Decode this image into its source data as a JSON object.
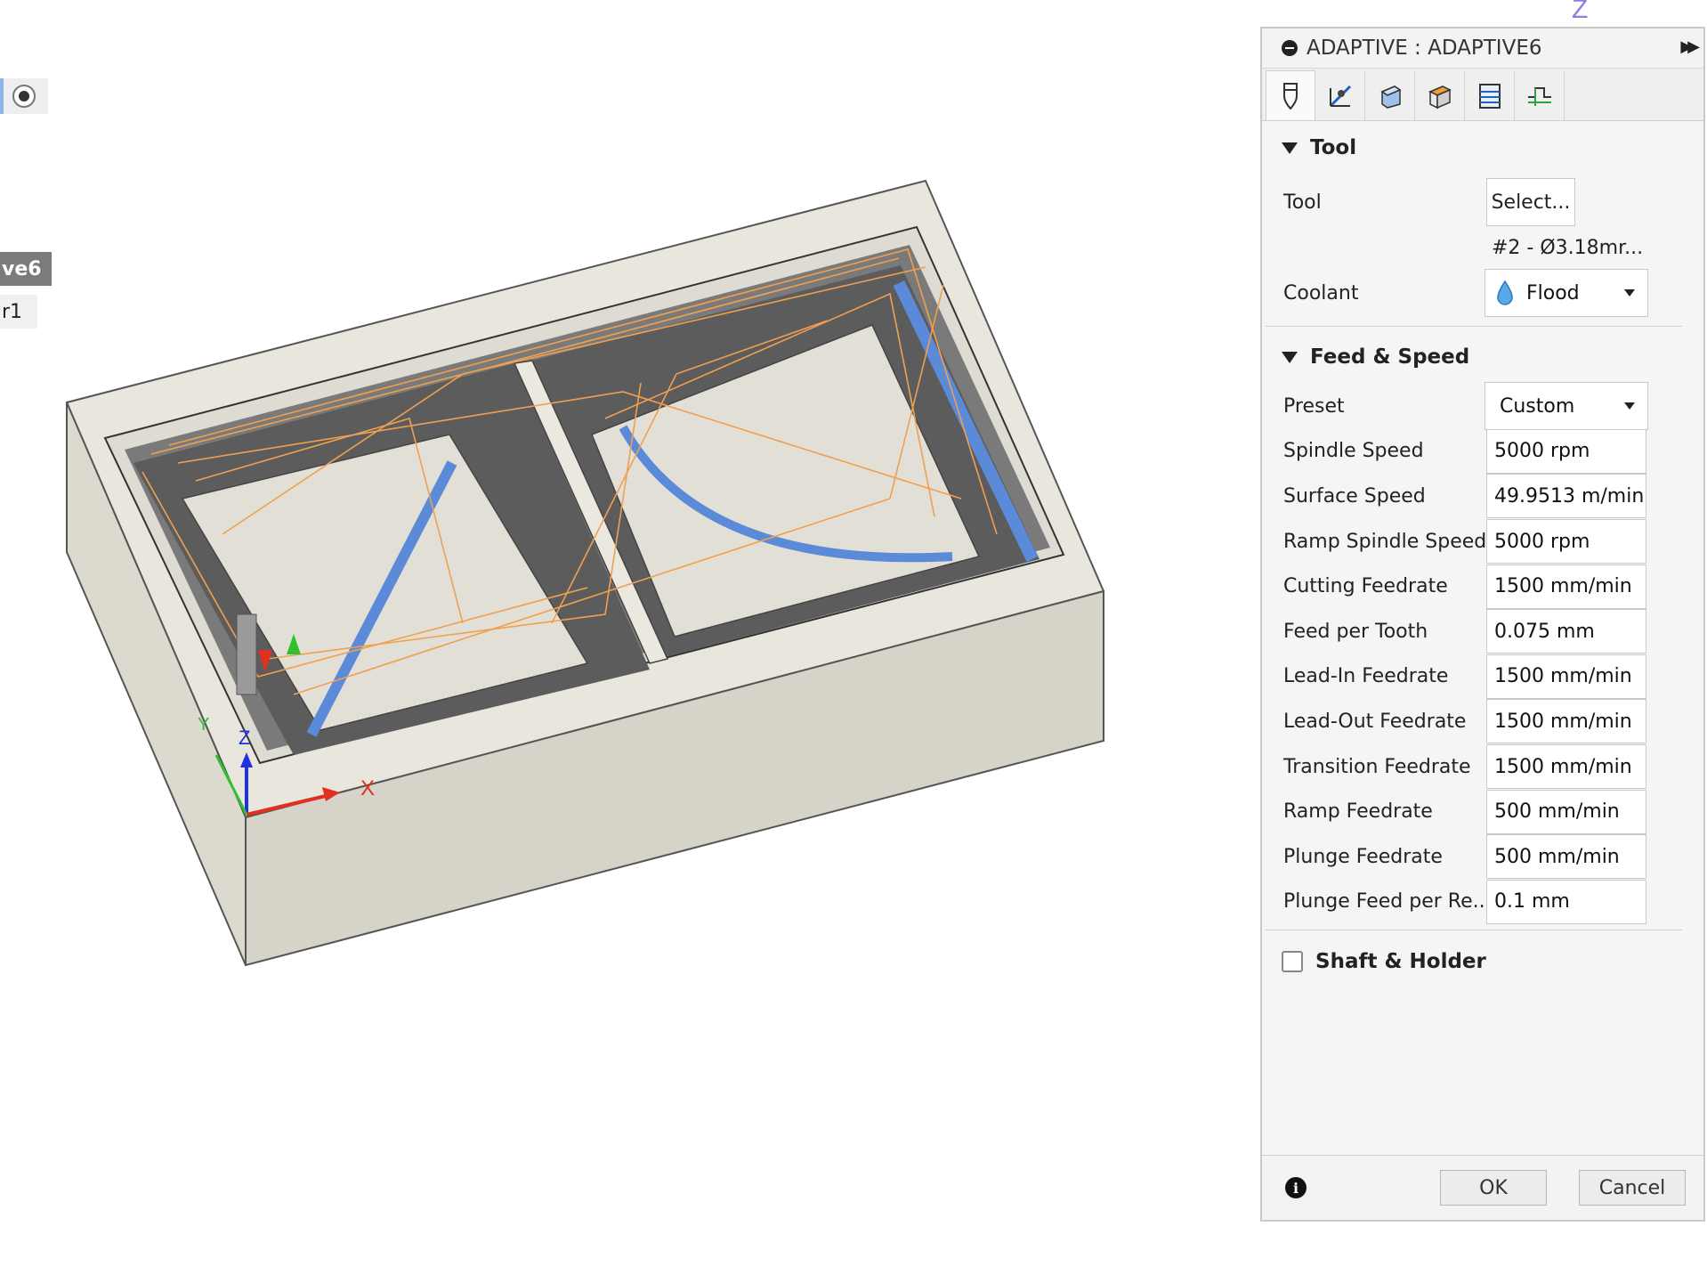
{
  "browser": {
    "active_item_label": "ve6",
    "setup_item_label": "r1"
  },
  "viewcube": {
    "axis_label": "Z"
  },
  "triad": {
    "x_label": "X",
    "y_label": "Y",
    "z_label": "Z"
  },
  "panel": {
    "title": "ADAPTIVE : ADAPTIVE6",
    "tabs": [
      "tool-icon",
      "geometry-icon",
      "heights-icon",
      "passes-icon",
      "linking-icon",
      "post-process-icon"
    ],
    "tool_section": {
      "title": "Tool",
      "tool_label": "Tool",
      "select_button": "Select...",
      "tool_description": "#2 - Ø3.18mr...",
      "coolant_label": "Coolant",
      "coolant_value": "Flood"
    },
    "feed_section": {
      "title": "Feed & Speed",
      "rows": [
        {
          "label": "Preset",
          "value": "Custom",
          "kind": "select"
        },
        {
          "label": "Spindle Speed",
          "value": "5000 rpm"
        },
        {
          "label": "Surface Speed",
          "value": "49.9513 m/min"
        },
        {
          "label": "Ramp Spindle Speed",
          "value": "5000 rpm"
        },
        {
          "label": "Cutting Feedrate",
          "value": "1500 mm/min"
        },
        {
          "label": "Feed per Tooth",
          "value": "0.075 mm"
        },
        {
          "label": "Lead-In Feedrate",
          "value": "1500 mm/min"
        },
        {
          "label": "Lead-Out Feedrate",
          "value": "1500 mm/min"
        },
        {
          "label": "Transition Feedrate",
          "value": "1500 mm/min"
        },
        {
          "label": "Ramp Feedrate",
          "value": "500 mm/min"
        },
        {
          "label": "Plunge Feedrate",
          "value": "500 mm/min"
        },
        {
          "label": "Plunge Feed per Re...",
          "value": "0.1 mm"
        }
      ]
    },
    "shaft_section": {
      "title": "Shaft & Holder"
    },
    "footer": {
      "ok": "OK",
      "cancel": "Cancel"
    }
  },
  "colors": {
    "stock": "#e6e3da",
    "stock_side": "#d4d1c6",
    "pocket_wall": "#4a4a4a",
    "toolpath_orange": "#f0a050",
    "toolpath_blue": "#5a8ad8",
    "axis_x": "#e03020",
    "axis_y": "#30c030",
    "axis_z": "#2030e0"
  }
}
